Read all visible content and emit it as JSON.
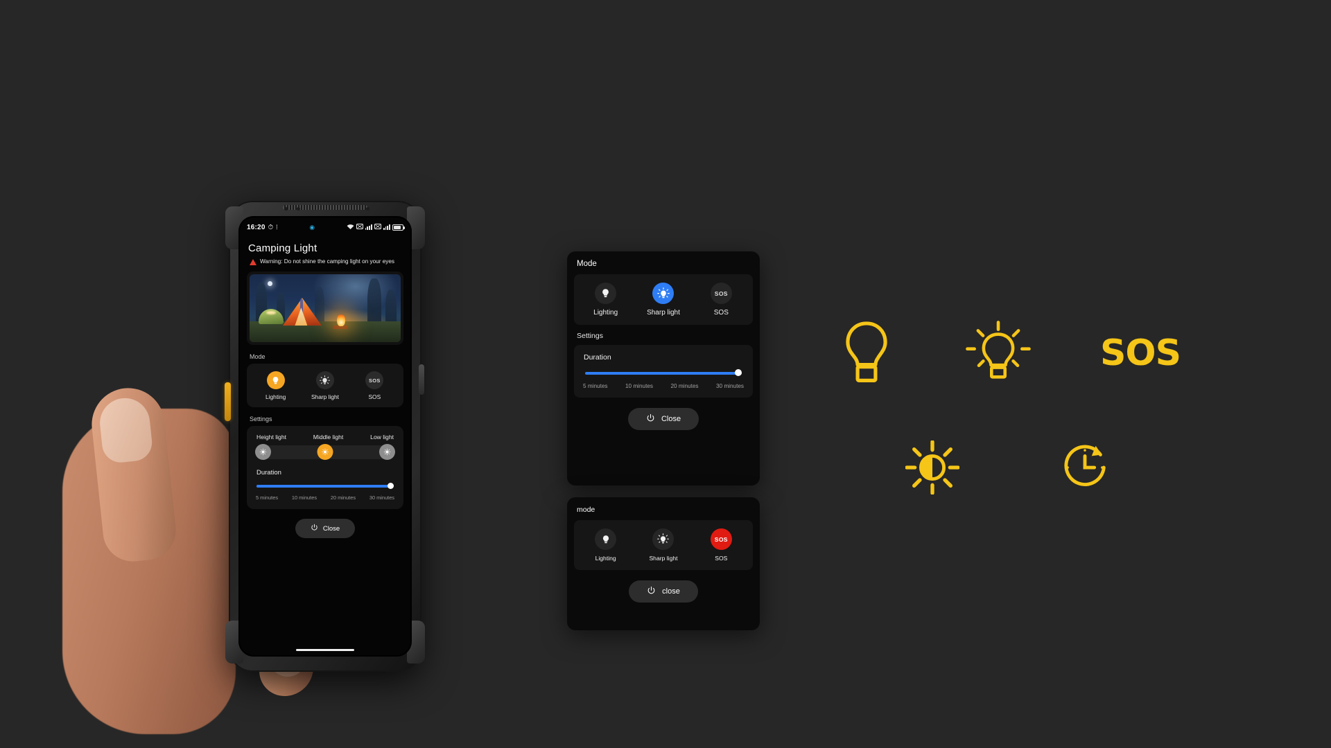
{
  "theme": {
    "page_bg": "#272727",
    "accent_yellow": "#F5C518",
    "accent_orange": "#F5A623",
    "accent_blue": "#2F7DF4",
    "accent_red": "#E01B12",
    "warning_red": "#E23B2E"
  },
  "phone": {
    "status_bar": {
      "time": "16:20",
      "icons_left": [
        "alarm-icon",
        "dnd-icon"
      ],
      "icon_center": "face-unlock-icon",
      "icons_right": [
        "wifi-icon",
        "sim1-icon",
        "signal1-icon",
        "sim2-icon",
        "signal2-icon",
        "battery-icon"
      ]
    },
    "app_title": "Camping Light",
    "warning_text": "Warning: Do not shine the camping light on your eyes",
    "hero_alt": "Campsite at night with a glowing tent and campfire in the forest",
    "mode_section": {
      "label": "Mode",
      "items": [
        {
          "label": "Lighting",
          "icon": "bulb-icon",
          "selected": true,
          "color": "#F5A623"
        },
        {
          "label": "Sharp light",
          "icon": "bulb-rays-icon",
          "selected": false,
          "color": "#2B2B2B"
        },
        {
          "label": "SOS",
          "icon": "sos-icon",
          "selected": false,
          "color": "#2B2B2B",
          "icon_text": "SOS"
        }
      ]
    },
    "settings_section": {
      "label": "Settings",
      "brightness": {
        "levels": [
          "Height light",
          "Middle light",
          "Low light"
        ],
        "selected_index": 1
      },
      "duration": {
        "label": "Duration",
        "ticks": [
          "5 minutes",
          "10 minutes",
          "20 minutes",
          "30 minutes"
        ],
        "value_percent": 100
      }
    },
    "close_button": {
      "label": "Close",
      "icon": "power-icon"
    }
  },
  "panel_a": {
    "header": "Mode",
    "modes": [
      {
        "label": "Lighting",
        "icon": "bulb-icon",
        "selected": false,
        "color": "#262626"
      },
      {
        "label": "Sharp light",
        "icon": "bulb-rays-icon",
        "selected": true,
        "color": "#2F7DF4"
      },
      {
        "label": "SOS",
        "icon": "sos-icon",
        "selected": false,
        "color": "#262626",
        "icon_text": "SOS"
      }
    ],
    "settings_label": "Settings",
    "duration": {
      "label": "Duration",
      "ticks": [
        "5 minutes",
        "10 minutes",
        "20 minutes",
        "30 minutes"
      ],
      "value_percent": 100
    },
    "close_button": {
      "label": "Close",
      "icon": "power-icon"
    }
  },
  "panel_b": {
    "header": "mode",
    "modes": [
      {
        "label": "Lighting",
        "icon": "bulb-icon",
        "selected": false,
        "color": "#262626"
      },
      {
        "label": "Sharp light",
        "icon": "bulb-rays-icon",
        "selected": false,
        "color": "#262626"
      },
      {
        "label": "SOS",
        "icon": "sos-icon",
        "selected": true,
        "color": "#E01B12",
        "icon_text": "SOS"
      }
    ],
    "close_button": {
      "label": "close",
      "icon": "power-icon"
    }
  },
  "icon_gallery": {
    "items": [
      {
        "name": "bulb-outline-icon",
        "caption": ""
      },
      {
        "name": "bulb-rays-icon",
        "caption": ""
      },
      {
        "name": "sos-text-icon",
        "caption": "SOS"
      },
      {
        "name": "brightness-sun-icon",
        "caption": ""
      },
      {
        "name": "timer-clock-icon",
        "caption": ""
      }
    ],
    "sos_text": "SOS"
  }
}
